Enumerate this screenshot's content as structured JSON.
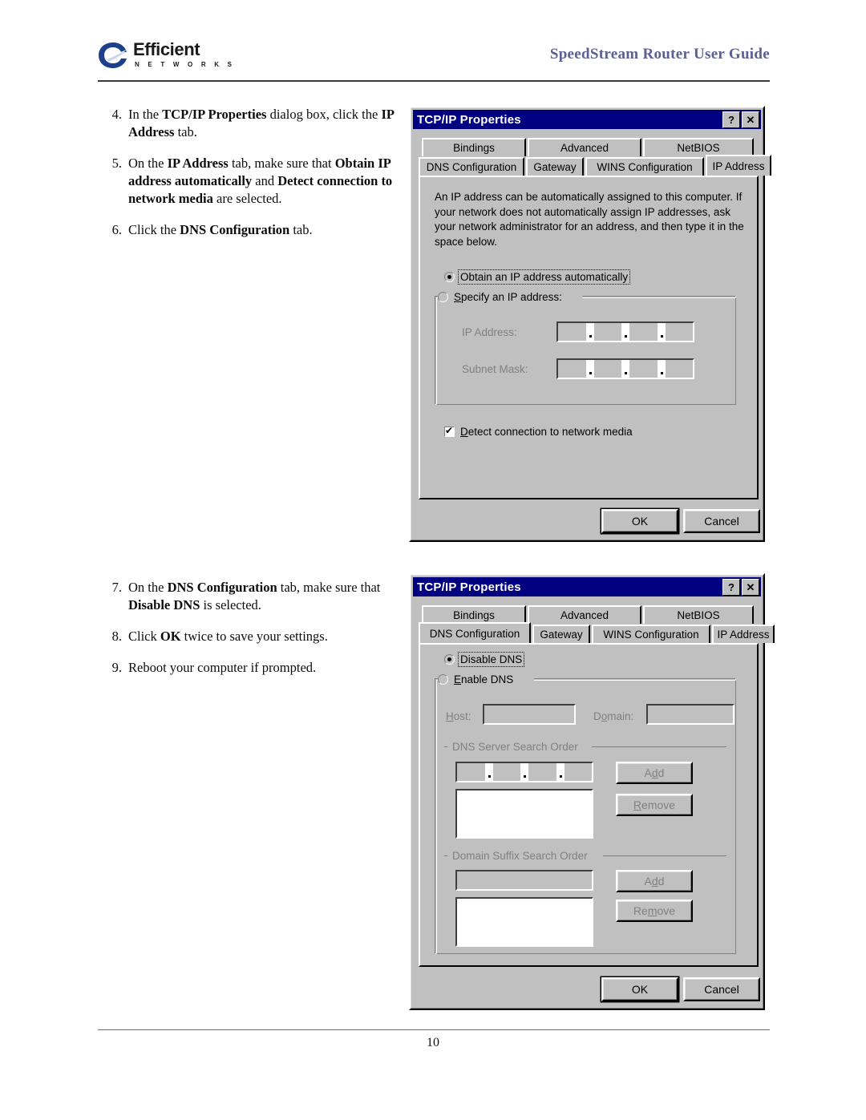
{
  "header": {
    "logo_name": "Efficient",
    "logo_sub": "N E T W O R K S",
    "guide_title": "SpeedStream Router User Guide",
    "title_color": "#5b5f93"
  },
  "footer": {
    "page_number": "10"
  },
  "steps_first": [
    {
      "num": "4.",
      "parts": [
        {
          "t": "In the ",
          "b": false
        },
        {
          "t": "TCP/IP Properties",
          "b": true
        },
        {
          "t": " dialog box, click the ",
          "b": false
        },
        {
          "t": "IP Address",
          "b": true
        },
        {
          "t": " tab.",
          "b": false
        }
      ]
    },
    {
      "num": "5.",
      "parts": [
        {
          "t": "On the ",
          "b": false
        },
        {
          "t": "IP Address",
          "b": true
        },
        {
          "t": " tab, make sure that ",
          "b": false
        },
        {
          "t": "Obtain IP address automatically",
          "b": true
        },
        {
          "t": " and ",
          "b": false
        },
        {
          "t": "Detect connection to network media",
          "b": true
        },
        {
          "t": " are selected.",
          "b": false
        }
      ]
    },
    {
      "num": "6.",
      "parts": [
        {
          "t": "Click the ",
          "b": false
        },
        {
          "t": "DNS Configuration",
          "b": true
        },
        {
          "t": " tab.",
          "b": false
        }
      ]
    }
  ],
  "steps_second": [
    {
      "num": "7.",
      "parts": [
        {
          "t": "On the ",
          "b": false
        },
        {
          "t": "DNS Configuration",
          "b": true
        },
        {
          "t": " tab, make sure that ",
          "b": false
        },
        {
          "t": "Disable DNS",
          "b": true
        },
        {
          "t": " is selected.",
          "b": false
        }
      ]
    },
    {
      "num": "8.",
      "parts": [
        {
          "t": "Click ",
          "b": false
        },
        {
          "t": "OK",
          "b": true
        },
        {
          "t": " twice to save your settings.",
          "b": false
        }
      ]
    },
    {
      "num": "9.",
      "parts": [
        {
          "t": "Reboot your computer if prompted.",
          "b": false
        }
      ]
    }
  ],
  "dialog_ip": {
    "title": "TCP/IP Properties",
    "titlebar_color": "#000080",
    "help_button": "?",
    "close_button": "✕",
    "tabs_row1": [
      "Bindings",
      "Advanced",
      "NetBIOS"
    ],
    "tabs_row2": [
      "DNS Configuration",
      "Gateway",
      "WINS Configuration",
      "IP Address"
    ],
    "active_tab": "IP Address",
    "description": "An IP address can be automatically assigned to this computer. If your network does not automatically assign IP addresses, ask your network administrator for an address, and then type it in the space below.",
    "radio_obtain": "Obtain an IP address automatically",
    "radio_specify": "Specify an IP address:",
    "selected_radio": "Obtain an IP address automatically",
    "label_ip_address": "IP Address:",
    "label_subnet_mask": "Subnet Mask:",
    "ip_address_value": "",
    "subnet_mask_value": "",
    "checkbox_detect": "Detect connection to network media",
    "checkbox_detect_checked": true,
    "ok_label": "OK",
    "cancel_label": "Cancel"
  },
  "dialog_dns": {
    "title": "TCP/IP Properties",
    "titlebar_color": "#000080",
    "help_button": "?",
    "close_button": "✕",
    "tabs_row1": [
      "Bindings",
      "Advanced",
      "NetBIOS"
    ],
    "tabs_row2": [
      "DNS Configuration",
      "Gateway",
      "WINS Configuration",
      "IP Address"
    ],
    "active_tab": "DNS Configuration",
    "radio_disable": "Disable DNS",
    "radio_enable": "Enable DNS",
    "selected_radio": "Disable DNS",
    "label_host": "Host:",
    "host_value": "",
    "label_domain": "Domain:",
    "domain_value": "",
    "group_dns_order": "DNS Server Search Order",
    "dns_order_entry": "",
    "dns_order_list": [],
    "dns_add_label": "Add",
    "dns_remove_label": "Remove",
    "group_suffix_order": "Domain Suffix Search Order",
    "suffix_order_entry": "",
    "suffix_order_list": [],
    "suffix_add_label": "Add",
    "suffix_remove_label": "Remove",
    "ok_label": "OK",
    "cancel_label": "Cancel"
  }
}
